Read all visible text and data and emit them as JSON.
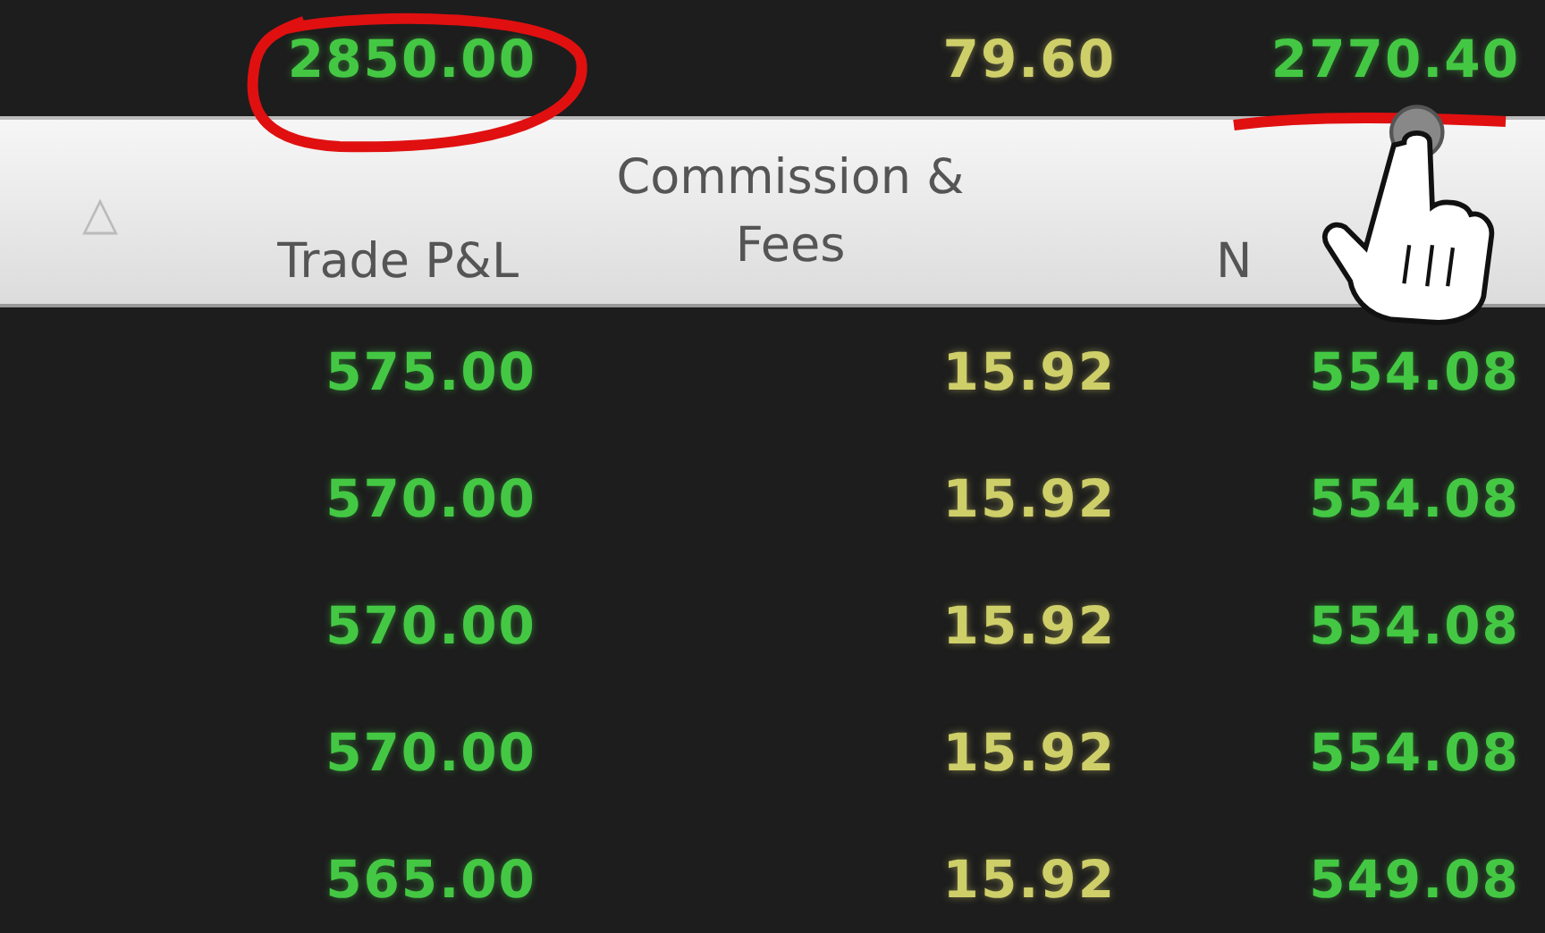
{
  "summary": {
    "trade_pl": "2850.00",
    "commission_fees": "79.60",
    "net_pl": "2770.40"
  },
  "table": {
    "sort": {
      "icon": "△"
    },
    "columns": [
      {
        "label": "Trade P&L"
      },
      {
        "label": "Commission &\nFees"
      },
      {
        "label": "N"
      }
    ],
    "rows": [
      {
        "trade_pl": "575.00",
        "commission_fees": "15.92",
        "net_pl": "554.08"
      },
      {
        "trade_pl": "570.00",
        "commission_fees": "15.92",
        "net_pl": "554.08"
      },
      {
        "trade_pl": "570.00",
        "commission_fees": "15.92",
        "net_pl": "554.08"
      },
      {
        "trade_pl": "570.00",
        "commission_fees": "15.92",
        "net_pl": "554.08"
      },
      {
        "trade_pl": "565.00",
        "commission_fees": "15.92",
        "net_pl": "549.08"
      }
    ]
  }
}
